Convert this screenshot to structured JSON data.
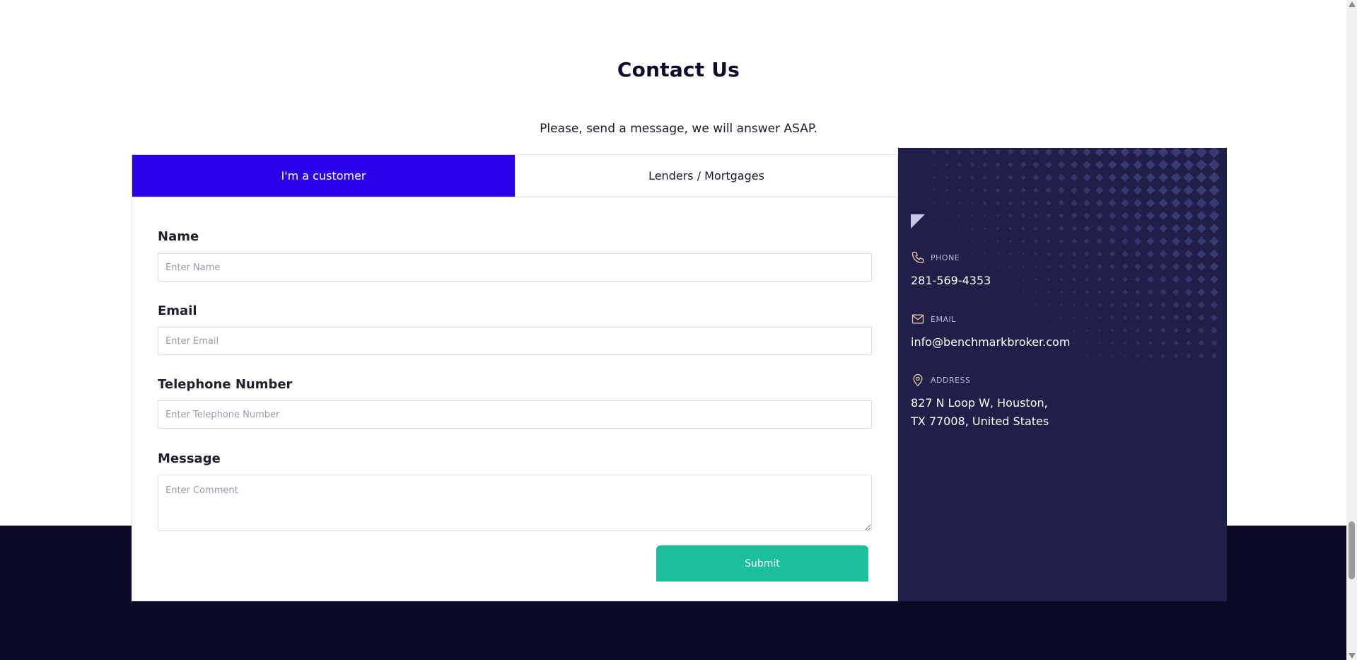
{
  "page": {
    "title": "Contact Us",
    "subtitle": "Please, send a message, we will answer ASAP."
  },
  "tabs": [
    {
      "label": "I'm a customer",
      "active": true
    },
    {
      "label": "Lenders / Mortgages",
      "active": false
    }
  ],
  "form": {
    "name": {
      "label": "Name",
      "placeholder": "Enter Name",
      "value": ""
    },
    "email": {
      "label": "Email",
      "placeholder": "Enter Email",
      "value": ""
    },
    "phone": {
      "label": "Telephone Number",
      "placeholder": "Enter Telephone Number",
      "value": ""
    },
    "message": {
      "label": "Message",
      "placeholder": "Enter Comment",
      "value": ""
    },
    "submit_label": "Submit"
  },
  "contact": {
    "phone": {
      "heading": "PHONE",
      "value": "281-569-4353",
      "icon": "phone-icon"
    },
    "email": {
      "heading": "EMAIL",
      "value": "info@benchmarkbroker.com",
      "icon": "mail-icon"
    },
    "address": {
      "heading": "ADDRESS",
      "line1": "827 N Loop W, Houston,",
      "line2": "TX 77008, United States",
      "icon": "location-pin-icon"
    }
  },
  "colors": {
    "tab_active": "#2a00e6",
    "submit": "#1bbf9a",
    "info_panel": "#1f1f4a",
    "footer": "#0b0a26",
    "icon_accent": "#e8c9a0"
  }
}
